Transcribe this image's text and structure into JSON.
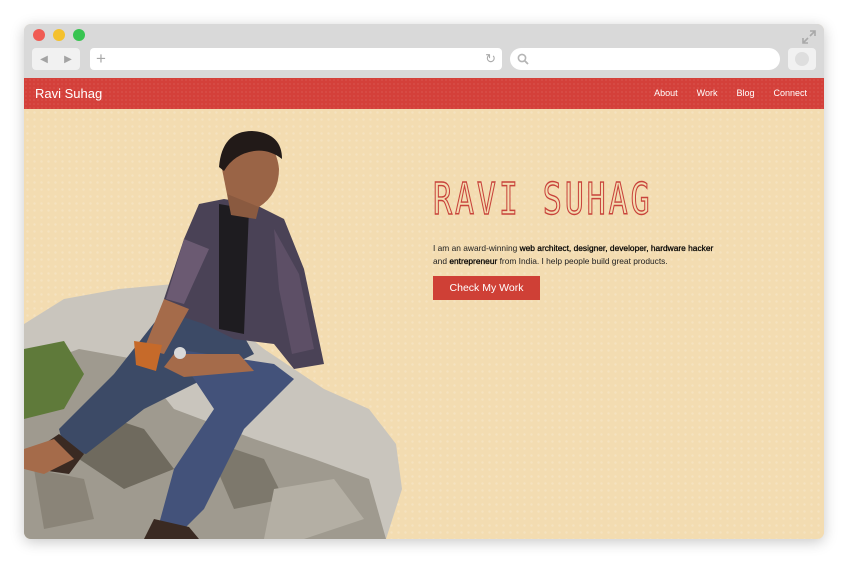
{
  "browser": {
    "url_placeholder": "",
    "back_icon": "back-arrow-icon",
    "forward_icon": "forward-arrow-icon"
  },
  "navbar": {
    "brand": "Ravi Suhag",
    "links": [
      "About",
      "Work",
      "Blog",
      "Connect"
    ],
    "color": "#d4403a"
  },
  "hero": {
    "title": "RAVI SUHAG",
    "bio_intro": "I am an award-winning ",
    "bio_roles": "web architect, designer, developer, hardware hacker",
    "bio_and": "and ",
    "bio_role2": "entrepreneur",
    "bio_outro": " from India. I help people build great products.",
    "cta_label": "Check My Work",
    "background": "#f3dcb1",
    "accent": "#cf4036"
  }
}
